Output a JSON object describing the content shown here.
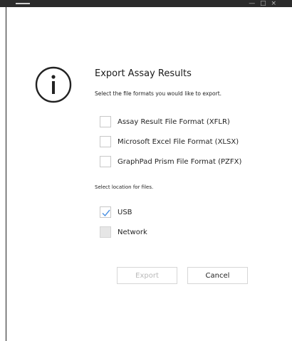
{
  "topbar": {
    "right_glyphs": "—  □  ×"
  },
  "dialog": {
    "title": "Export Assay Results",
    "subtitle": "Select the file formats you would like to export.",
    "formats": [
      {
        "label": "Assay Result File Format (XFLR)",
        "checked": false
      },
      {
        "label": "Microsoft Excel File Format (XLSX)",
        "checked": false
      },
      {
        "label": "GraphPad Prism File Format (PZFX)",
        "checked": false
      }
    ],
    "location_label": "Select location for files.",
    "locations": [
      {
        "label": "USB",
        "checked": true
      },
      {
        "label": "Network",
        "checked": false,
        "disabled": true
      }
    ],
    "buttons": {
      "export": "Export",
      "cancel": "Cancel"
    }
  },
  "colors": {
    "accent": "#4a90e2",
    "disabled_text": "#b9b9b9"
  },
  "icons": {
    "info": "info-circle-icon",
    "check": "checkmark-icon"
  }
}
